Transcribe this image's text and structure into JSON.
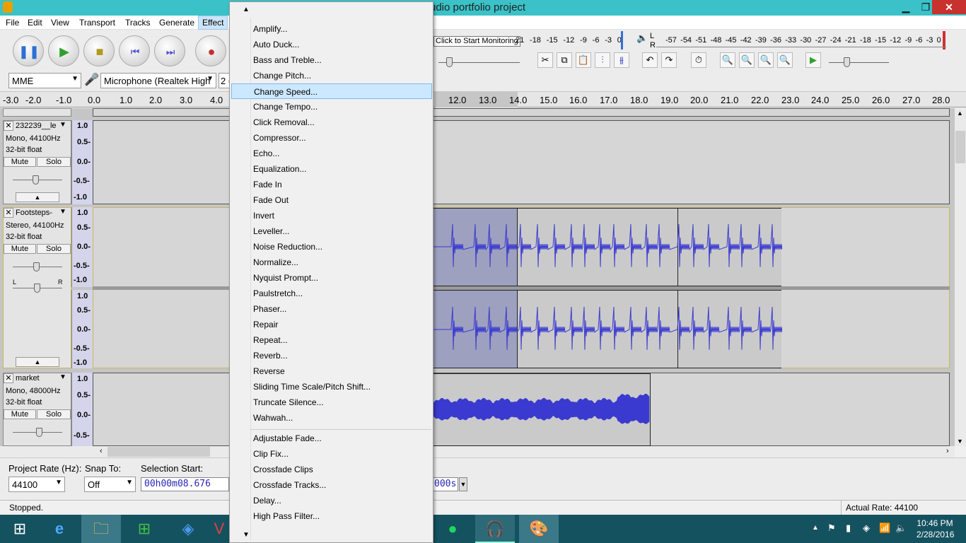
{
  "window": {
    "title": "udio portfolio project",
    "min": "▁",
    "max": "❐",
    "close": "✕"
  },
  "menubar": [
    "File",
    "Edit",
    "View",
    "Transport",
    "Tracks",
    "Generate",
    "Effect"
  ],
  "transport_buttons": [
    "pause-icon",
    "play-icon",
    "stop-icon",
    "skip-start-icon",
    "skip-end-icon",
    "record-icon"
  ],
  "meter": {
    "monitor_text": "Click to Start Monitoring",
    "rec_ticks_visible": [
      "21",
      "-18",
      "-15",
      "-12",
      "-9",
      "-6",
      "-3",
      "0"
    ],
    "play_ticks": [
      "-57",
      "-54",
      "-51",
      "-48",
      "-45",
      "-42",
      "-39",
      "-36",
      "-33",
      "-30",
      "-27",
      "-24",
      "-21",
      "-18",
      "-15",
      "-12",
      "-9",
      "-6",
      "-3",
      "0"
    ],
    "lr_top": "L",
    "lr_bottom": "R"
  },
  "device": {
    "host": "MME",
    "input": "Microphone (Realtek High",
    "channels": "2 ("
  },
  "ruler_ticks": [
    "-3.0",
    "-2.0",
    "-1.0",
    "0.0",
    "1.0",
    "2.0",
    "3.0",
    "4.0",
    "12.0",
    "13.0",
    "14.0",
    "15.0",
    "16.0",
    "17.0",
    "18.0",
    "19.0",
    "20.0",
    "21.0",
    "22.0",
    "23.0",
    "24.0",
    "25.0",
    "26.0",
    "27.0",
    "28.0"
  ],
  "tracks": [
    {
      "name": "232239__le",
      "info1": "Mono, 44100Hz",
      "info2": "32-bit float",
      "mute": "Mute",
      "solo": "Solo",
      "scale": [
        "1.0",
        "0.5-",
        "0.0-",
        "-0.5-",
        "-1.0"
      ]
    },
    {
      "name": "Footsteps-",
      "info1": "Stereo, 44100Hz",
      "info2": "32-bit float",
      "mute": "Mute",
      "solo": "Solo",
      "scale": [
        "1.0",
        "0.5-",
        "0.0-",
        "-0.5-",
        "-1.0"
      ],
      "scale2": [
        "1.0",
        "0.5-",
        "0.0-",
        "-0.5-",
        "-1.0"
      ],
      "pan_l": "L",
      "pan_r": "R"
    },
    {
      "name": "market",
      "info1": "Mono, 48000Hz",
      "info2": "32-bit float",
      "mute": "Mute",
      "solo": "Solo",
      "scale": [
        "1.0",
        "0.5-",
        "0.0-",
        "-0.5-"
      ]
    }
  ],
  "selection_bar": {
    "rate_label": "Project Rate (Hz):",
    "rate_value": "44100",
    "snap_label": "Snap To:",
    "snap_value": "Off",
    "start_label": "Selection Start:",
    "start_value": "00h00m08.676",
    "end_tail": "000s"
  },
  "status": {
    "left": "Stopped.",
    "right": "Actual Rate: 44100"
  },
  "taskbar": {
    "time": "10:46 PM",
    "date": "2/28/2016"
  },
  "effect_menu": {
    "items": [
      "Amplify...",
      "Auto Duck...",
      "Bass and Treble...",
      "Change Pitch...",
      "Change Speed...",
      "Change Tempo...",
      "Click Removal...",
      "Compressor...",
      "Echo...",
      "Equalization...",
      "Fade In",
      "Fade Out",
      "Invert",
      "Leveller...",
      "Noise Reduction...",
      "Normalize...",
      "Nyquist Prompt...",
      "Paulstretch...",
      "Phaser...",
      "Repair",
      "Repeat...",
      "Reverb...",
      "Reverse",
      "Sliding Time Scale/Pitch Shift...",
      "Truncate Silence...",
      "Wahwah..."
    ],
    "items2": [
      "Adjustable Fade...",
      "Clip Fix...",
      "Crossfade Clips",
      "Crossfade Tracks...",
      "Delay...",
      "High Pass Filter..."
    ],
    "highlighted": "Change Speed...",
    "up": "▲",
    "down": "▼"
  },
  "colors": {
    "titlebar": "#3ac2c8",
    "waveform": "#3a3ad0",
    "taskbar": "#155260",
    "highlight": "#cce8ff"
  }
}
